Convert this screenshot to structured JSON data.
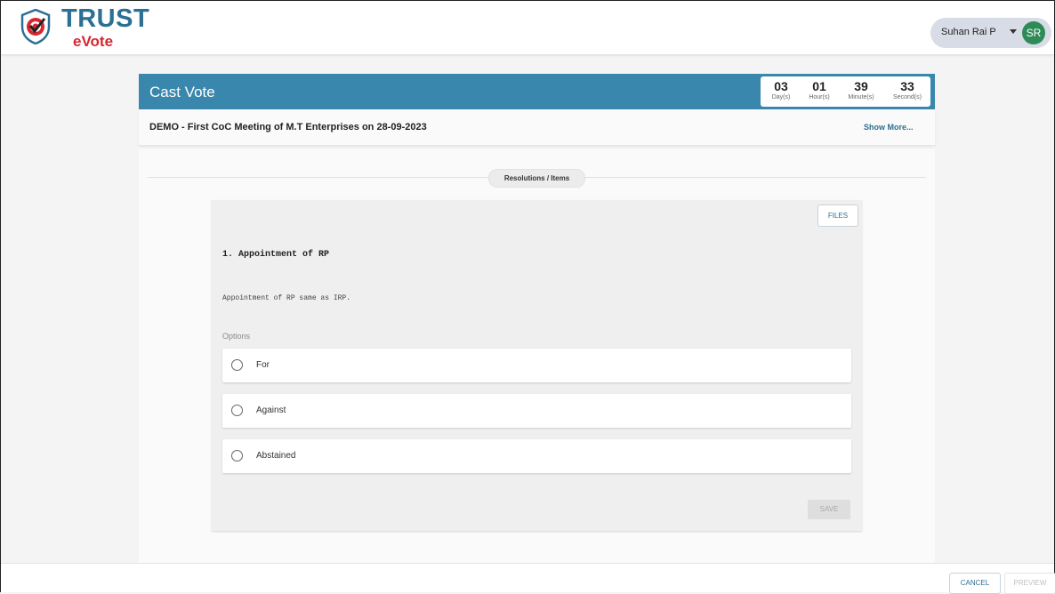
{
  "brand": {
    "name": "TRUST",
    "sub": "eVote",
    "primary": "#2b6f92",
    "accent": "#d7262e"
  },
  "user": {
    "name": "Suhan Rai P",
    "initials": "SR",
    "avatar_color": "#2e8b57"
  },
  "header": {
    "title": "Cast Vote",
    "bar_color": "#3a87ad"
  },
  "timer": [
    {
      "value": "03",
      "unit": "Day(s)"
    },
    {
      "value": "01",
      "unit": "Hour(s)"
    },
    {
      "value": "39",
      "unit": "Minute(s)"
    },
    {
      "value": "33",
      "unit": "Second(s)"
    }
  ],
  "meeting": {
    "title": "DEMO - First CoC Meeting of M.T Enterprises on 28-09-2023",
    "show_more": "Show More..."
  },
  "section": {
    "label": "Resolutions / Items"
  },
  "item": {
    "files_label": "FILES",
    "title": "1. Appointment of RP",
    "description": "Appointment of  RP same as IRP.",
    "options_label": "Options",
    "options": [
      {
        "label": "For",
        "selected": false
      },
      {
        "label": "Against",
        "selected": false
      },
      {
        "label": "Abstained",
        "selected": false
      }
    ],
    "save_label": "SAVE"
  },
  "footer": {
    "cancel_label": "CANCEL",
    "preview_label": "PREVIEW"
  }
}
